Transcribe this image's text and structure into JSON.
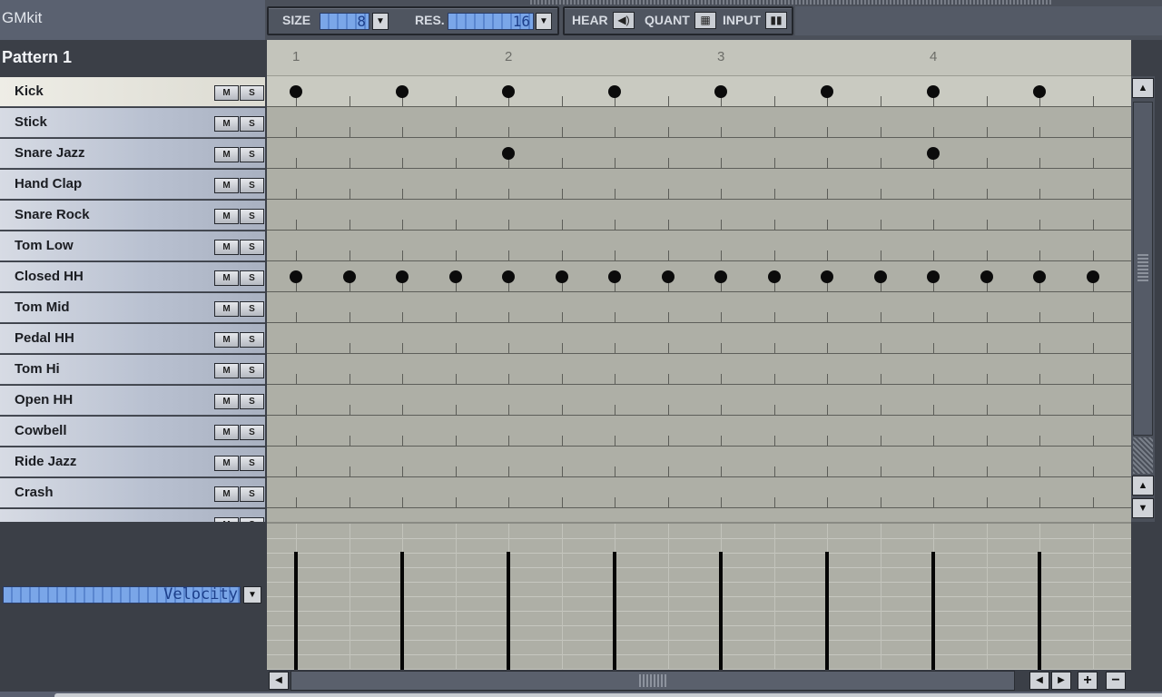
{
  "kit": {
    "name": "GMkit"
  },
  "toolbar": {
    "size_label": "SIZE",
    "size_value": "8",
    "res_label": "RES.",
    "res_value": "16",
    "hear_label": "HEAR",
    "quant_label": "QUANT",
    "input_label": "INPUT",
    "icons": {
      "dropdown": "chevron-down-icon",
      "hear": "speaker-icon",
      "quant": "grid-icon",
      "input": "piano-keys-icon"
    }
  },
  "pattern": {
    "title": "Pattern 1"
  },
  "ruler": {
    "beats": [
      "1",
      "2",
      "3",
      "4"
    ]
  },
  "instruments": [
    {
      "name": "Kick",
      "selected": true,
      "mute": "M",
      "solo": "S",
      "hits": [
        0,
        2,
        4,
        6,
        8,
        10,
        12,
        14
      ]
    },
    {
      "name": "Stick",
      "mute": "M",
      "solo": "S",
      "hits": []
    },
    {
      "name": "Snare Jazz",
      "mute": "M",
      "solo": "S",
      "hits": [
        4,
        12
      ]
    },
    {
      "name": "Hand Clap",
      "mute": "M",
      "solo": "S",
      "hits": []
    },
    {
      "name": "Snare Rock",
      "mute": "M",
      "solo": "S",
      "hits": []
    },
    {
      "name": "Tom Low",
      "mute": "M",
      "solo": "S",
      "hits": []
    },
    {
      "name": "Closed HH",
      "mute": "M",
      "solo": "S",
      "hits": [
        0,
        1,
        2,
        3,
        4,
        5,
        6,
        7,
        8,
        9,
        10,
        11,
        12,
        13,
        14,
        15
      ]
    },
    {
      "name": "Tom Mid",
      "mute": "M",
      "solo": "S",
      "hits": []
    },
    {
      "name": "Pedal HH",
      "mute": "M",
      "solo": "S",
      "hits": []
    },
    {
      "name": "Tom Hi",
      "mute": "M",
      "solo": "S",
      "hits": []
    },
    {
      "name": "Open HH",
      "mute": "M",
      "solo": "S",
      "hits": []
    },
    {
      "name": "Cowbell",
      "mute": "M",
      "solo": "S",
      "hits": []
    },
    {
      "name": "Ride Jazz",
      "mute": "M",
      "solo": "S",
      "hits": []
    },
    {
      "name": "Crash",
      "mute": "M",
      "solo": "S",
      "hits": []
    },
    {
      "name": "",
      "mute": "M",
      "solo": "S",
      "hits": []
    }
  ],
  "velocity": {
    "selector_value": "Velocity",
    "level": 1.0
  },
  "scrollbars": {
    "up_icon": "arrow-up-icon",
    "down_icon": "arrow-down-icon",
    "left_icon": "arrow-left-icon",
    "right_icon": "arrow-right-icon",
    "zoom_in": "+",
    "zoom_out": "−"
  },
  "colors": {
    "lcd": "#7aa6e8",
    "grid": "#aeafa6",
    "note": "#0b0b0b"
  }
}
